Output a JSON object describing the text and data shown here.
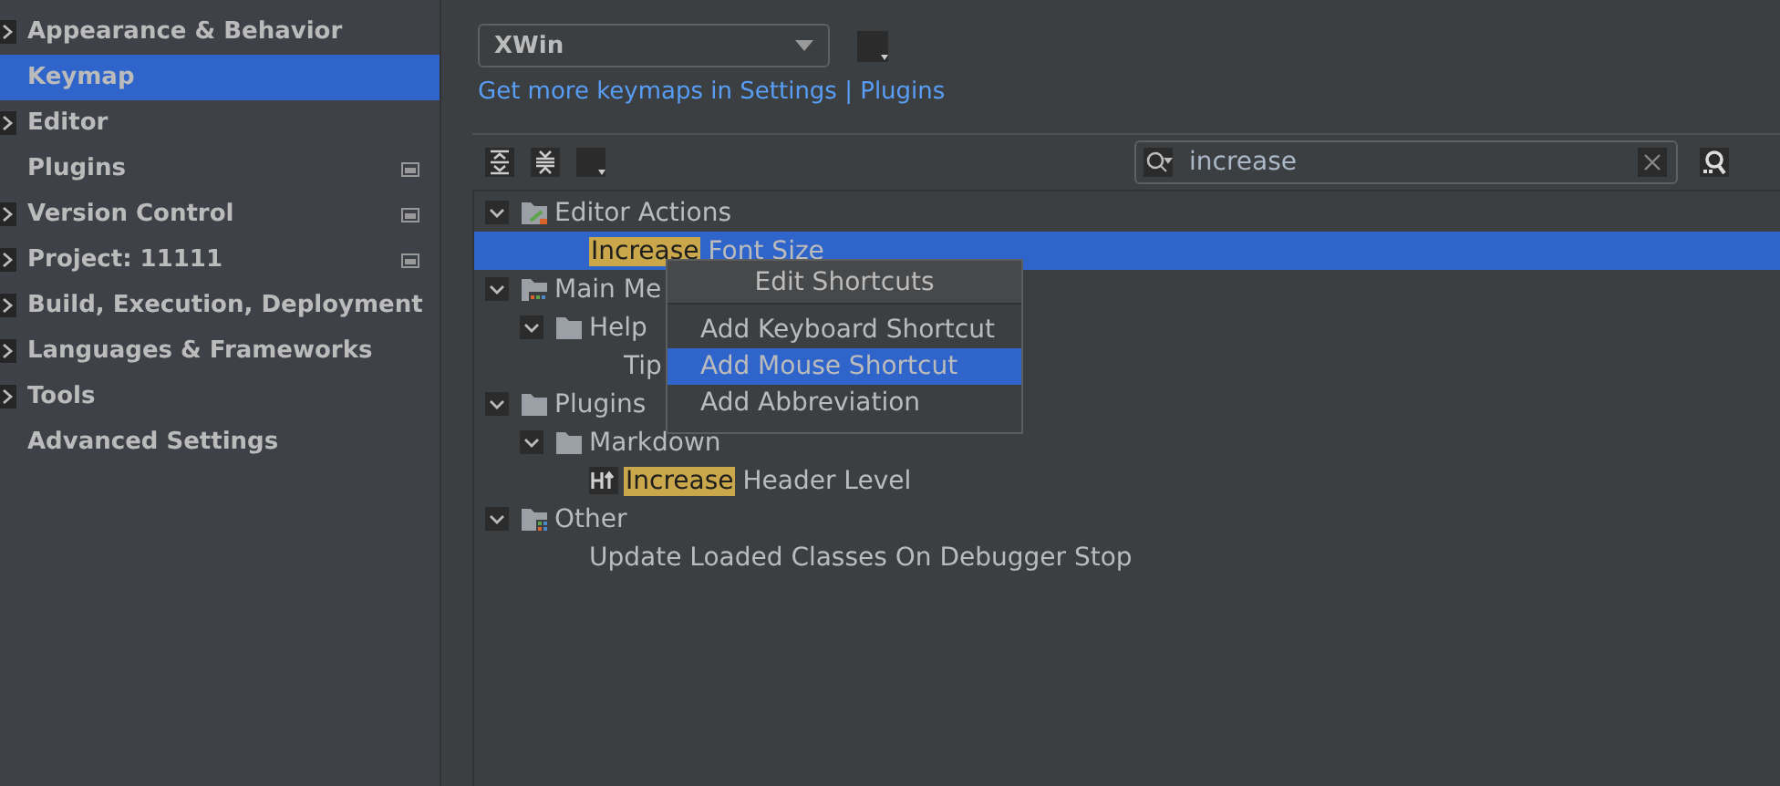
{
  "sidebar": {
    "items": [
      {
        "label": "Appearance & Behavior",
        "expandable": true,
        "project_level": false,
        "selected": false
      },
      {
        "label": "Keymap",
        "expandable": false,
        "project_level": false,
        "selected": true
      },
      {
        "label": "Editor",
        "expandable": true,
        "project_level": false,
        "selected": false
      },
      {
        "label": "Plugins",
        "expandable": false,
        "project_level": true,
        "selected": false
      },
      {
        "label": "Version Control",
        "expandable": true,
        "project_level": true,
        "selected": false
      },
      {
        "label": "Project: 11111",
        "expandable": true,
        "project_level": true,
        "selected": false
      },
      {
        "label": "Build, Execution, Deployment",
        "expandable": true,
        "project_level": false,
        "selected": false
      },
      {
        "label": "Languages & Frameworks",
        "expandable": true,
        "project_level": false,
        "selected": false
      },
      {
        "label": "Tools",
        "expandable": true,
        "project_level": false,
        "selected": false
      },
      {
        "label": "Advanced Settings",
        "expandable": false,
        "project_level": false,
        "selected": false
      }
    ]
  },
  "keymap": {
    "value": "XWin"
  },
  "link": "Get more keymaps in Settings | Plugins",
  "search": {
    "value": "increase"
  },
  "tree": [
    {
      "label": "Editor Actions",
      "kind": "actions",
      "expanded": true,
      "selected": false,
      "children": [
        {
          "match": "Increase",
          "label": "Font Size",
          "kind": "action",
          "selected": true
        }
      ]
    },
    {
      "label": "Main Me",
      "kind": "menu",
      "expanded": true,
      "selected": false,
      "children": [
        {
          "label": "Help",
          "kind": "folder",
          "expanded": true,
          "selected": false,
          "children": [
            {
              "label": "Tip",
              "kind": "action",
              "selected": false
            }
          ]
        }
      ]
    },
    {
      "label": "Plugins",
      "kind": "folder",
      "expanded": true,
      "selected": false,
      "children": [
        {
          "label": "Markdown",
          "kind": "folder",
          "expanded": true,
          "selected": false,
          "children": [
            {
              "match": "Increase",
              "label": "Header Level",
              "kind": "header-action",
              "selected": false
            }
          ]
        }
      ]
    },
    {
      "label": "Other",
      "kind": "other",
      "expanded": true,
      "selected": false,
      "children": [
        {
          "label": "Update Loaded Classes On Debugger Stop",
          "kind": "action",
          "selected": false
        }
      ]
    }
  ],
  "popup": {
    "title": "Edit Shortcuts",
    "items": [
      {
        "label": "Add Keyboard Shortcut",
        "selected": false
      },
      {
        "label": "Add Mouse Shortcut",
        "selected": true
      },
      {
        "label": "Add Abbreviation",
        "selected": false
      }
    ]
  }
}
